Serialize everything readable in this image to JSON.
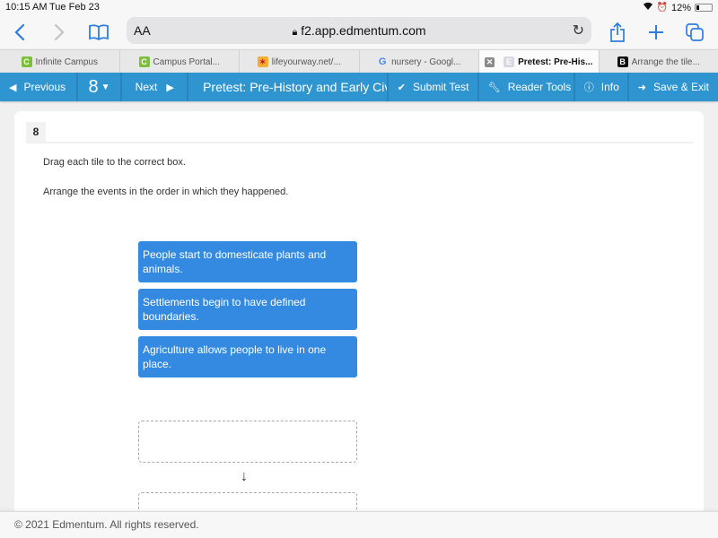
{
  "status_bar": {
    "time": "10:15 AM",
    "date": "Tue Feb 23",
    "battery": "12%"
  },
  "browser": {
    "text_size_label": "AA",
    "url": "f2.app.edmentum.com",
    "icons": [
      "back-icon",
      "forward-icon",
      "bookmarks-icon",
      "lock-icon",
      "reload-icon",
      "share-icon",
      "new-tab-icon",
      "tabs-icon"
    ]
  },
  "tabs": [
    {
      "label": "Infinite Campus",
      "favicon": "C",
      "active": false
    },
    {
      "label": "Campus Portal...",
      "favicon": "C",
      "active": false
    },
    {
      "label": "lifeyourway.net/...",
      "favicon": "✶",
      "active": false
    },
    {
      "label": "nursery - Googl...",
      "favicon": "G",
      "active": false
    },
    {
      "label": "Pretest: Pre-His...",
      "favicon": "E",
      "active": true
    },
    {
      "label": "Arrange the tile...",
      "favicon": "B",
      "active": false
    }
  ],
  "nav": {
    "previous": "Previous",
    "question_number": "8",
    "next": "Next",
    "title": "Pretest: Pre-History and Early Civilizations",
    "submit": "Submit Test",
    "reader_tools": "Reader Tools",
    "info": "Info",
    "save_exit": "Save & Exit"
  },
  "question": {
    "number": "8",
    "instruction_1": "Drag each tile to the correct box.",
    "instruction_2": "Arrange the events in the order in which they happened.",
    "tiles": [
      "People start to domesticate plants and animals.",
      "Settlements begin to have defined boundaries.",
      "Agriculture allows people to live in one place."
    ],
    "drop_boxes": [
      "",
      ""
    ],
    "arrow": "↓"
  },
  "footer": {
    "copyright": "© 2021 Edmentum. All rights reserved."
  },
  "colors": {
    "nav_bg": "#2f95d0",
    "tile_bg": "#348ae0",
    "ios_blue": "#2f7de1"
  }
}
